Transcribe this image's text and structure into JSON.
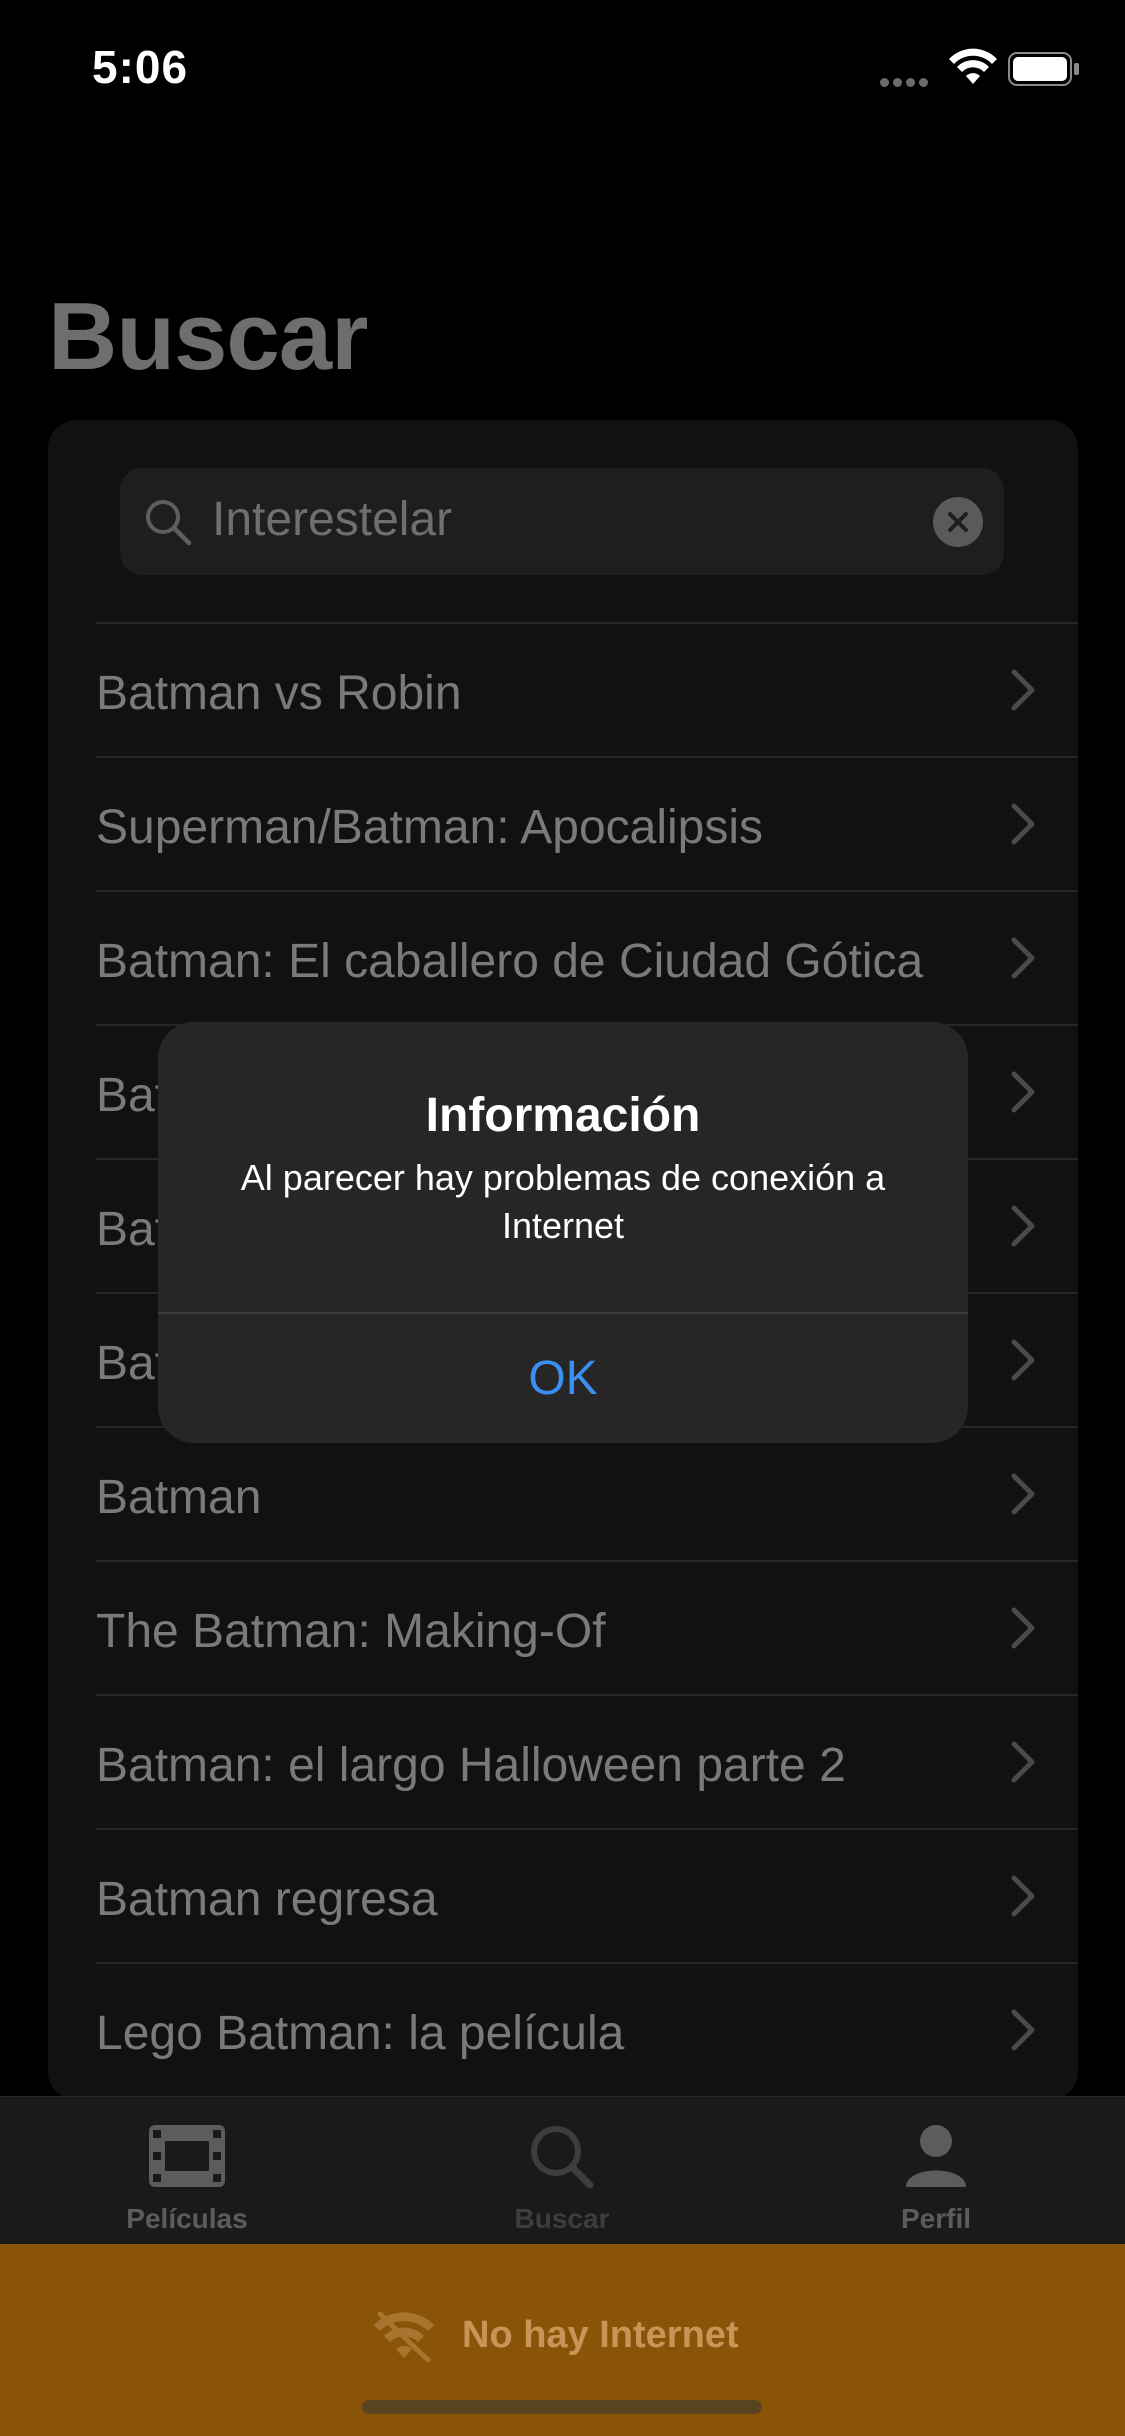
{
  "status_bar": {
    "time": "5:06"
  },
  "page": {
    "title": "Buscar"
  },
  "search": {
    "value": "Interestelar"
  },
  "results": [
    {
      "label": "Batman vs Robin"
    },
    {
      "label": "Superman/Batman: Apocalipsis"
    },
    {
      "label": "Batman: El caballero de Ciudad Gótica"
    },
    {
      "label": "Bat"
    },
    {
      "label": "Bat"
    },
    {
      "label": "Bat"
    },
    {
      "label": "Batman"
    },
    {
      "label": "The Batman: Making-Of"
    },
    {
      "label": "Batman: el largo Halloween parte 2"
    },
    {
      "label": "Batman regresa"
    },
    {
      "label": "Lego Batman: la película"
    }
  ],
  "tab_bar": {
    "tabs": [
      {
        "label": "Películas",
        "icon": "film-icon"
      },
      {
        "label": "Buscar",
        "icon": "search-icon"
      },
      {
        "label": "Perfil",
        "icon": "person-icon"
      }
    ],
    "active": "Buscar"
  },
  "banner": {
    "message": "No hay Internet",
    "icon": "wifi-off-icon",
    "color": "#8a5408"
  },
  "alert": {
    "title": "Información",
    "message": "Al parecer hay problemas de conexión a Internet",
    "button": "OK",
    "button_color": "#3b8ff0"
  }
}
